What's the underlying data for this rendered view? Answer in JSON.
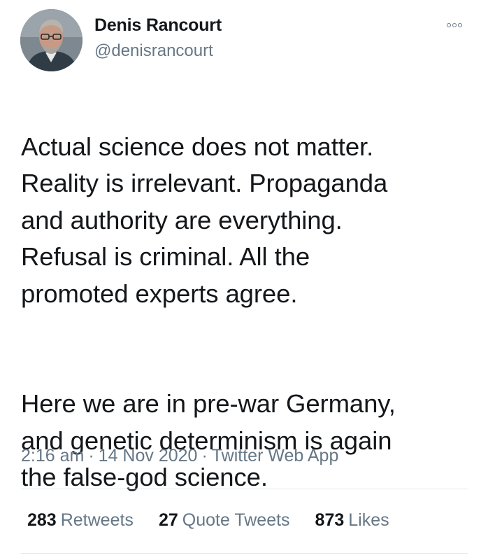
{
  "author": {
    "name": "Denis Rancourt",
    "handle": "@denisrancourt",
    "avatar_icon": "avatar-photo"
  },
  "menu": {
    "icon": "more-options-icon"
  },
  "tweet": {
    "paragraphs": [
      "Actual science does not matter.\nReality is irrelevant. Propaganda\nand authority are everything.\nRefusal is criminal. All the\npromoted experts agree.",
      "Here we are in pre-war Germany,\nand genetic determinism is again\nthe false-god science."
    ]
  },
  "meta": {
    "time": "2:16 am",
    "separator": "·",
    "date": "14 Nov 2020",
    "app": "Twitter Web App"
  },
  "stats": {
    "retweets_count": "283",
    "retweets_label": "Retweets",
    "quotes_count": "27",
    "quotes_label": "Quote Tweets",
    "likes_count": "873",
    "likes_label": "Likes"
  },
  "colors": {
    "text_primary": "#14171a",
    "text_secondary": "#657786",
    "divider": "#e1e8ed",
    "background": "#ffffff"
  }
}
